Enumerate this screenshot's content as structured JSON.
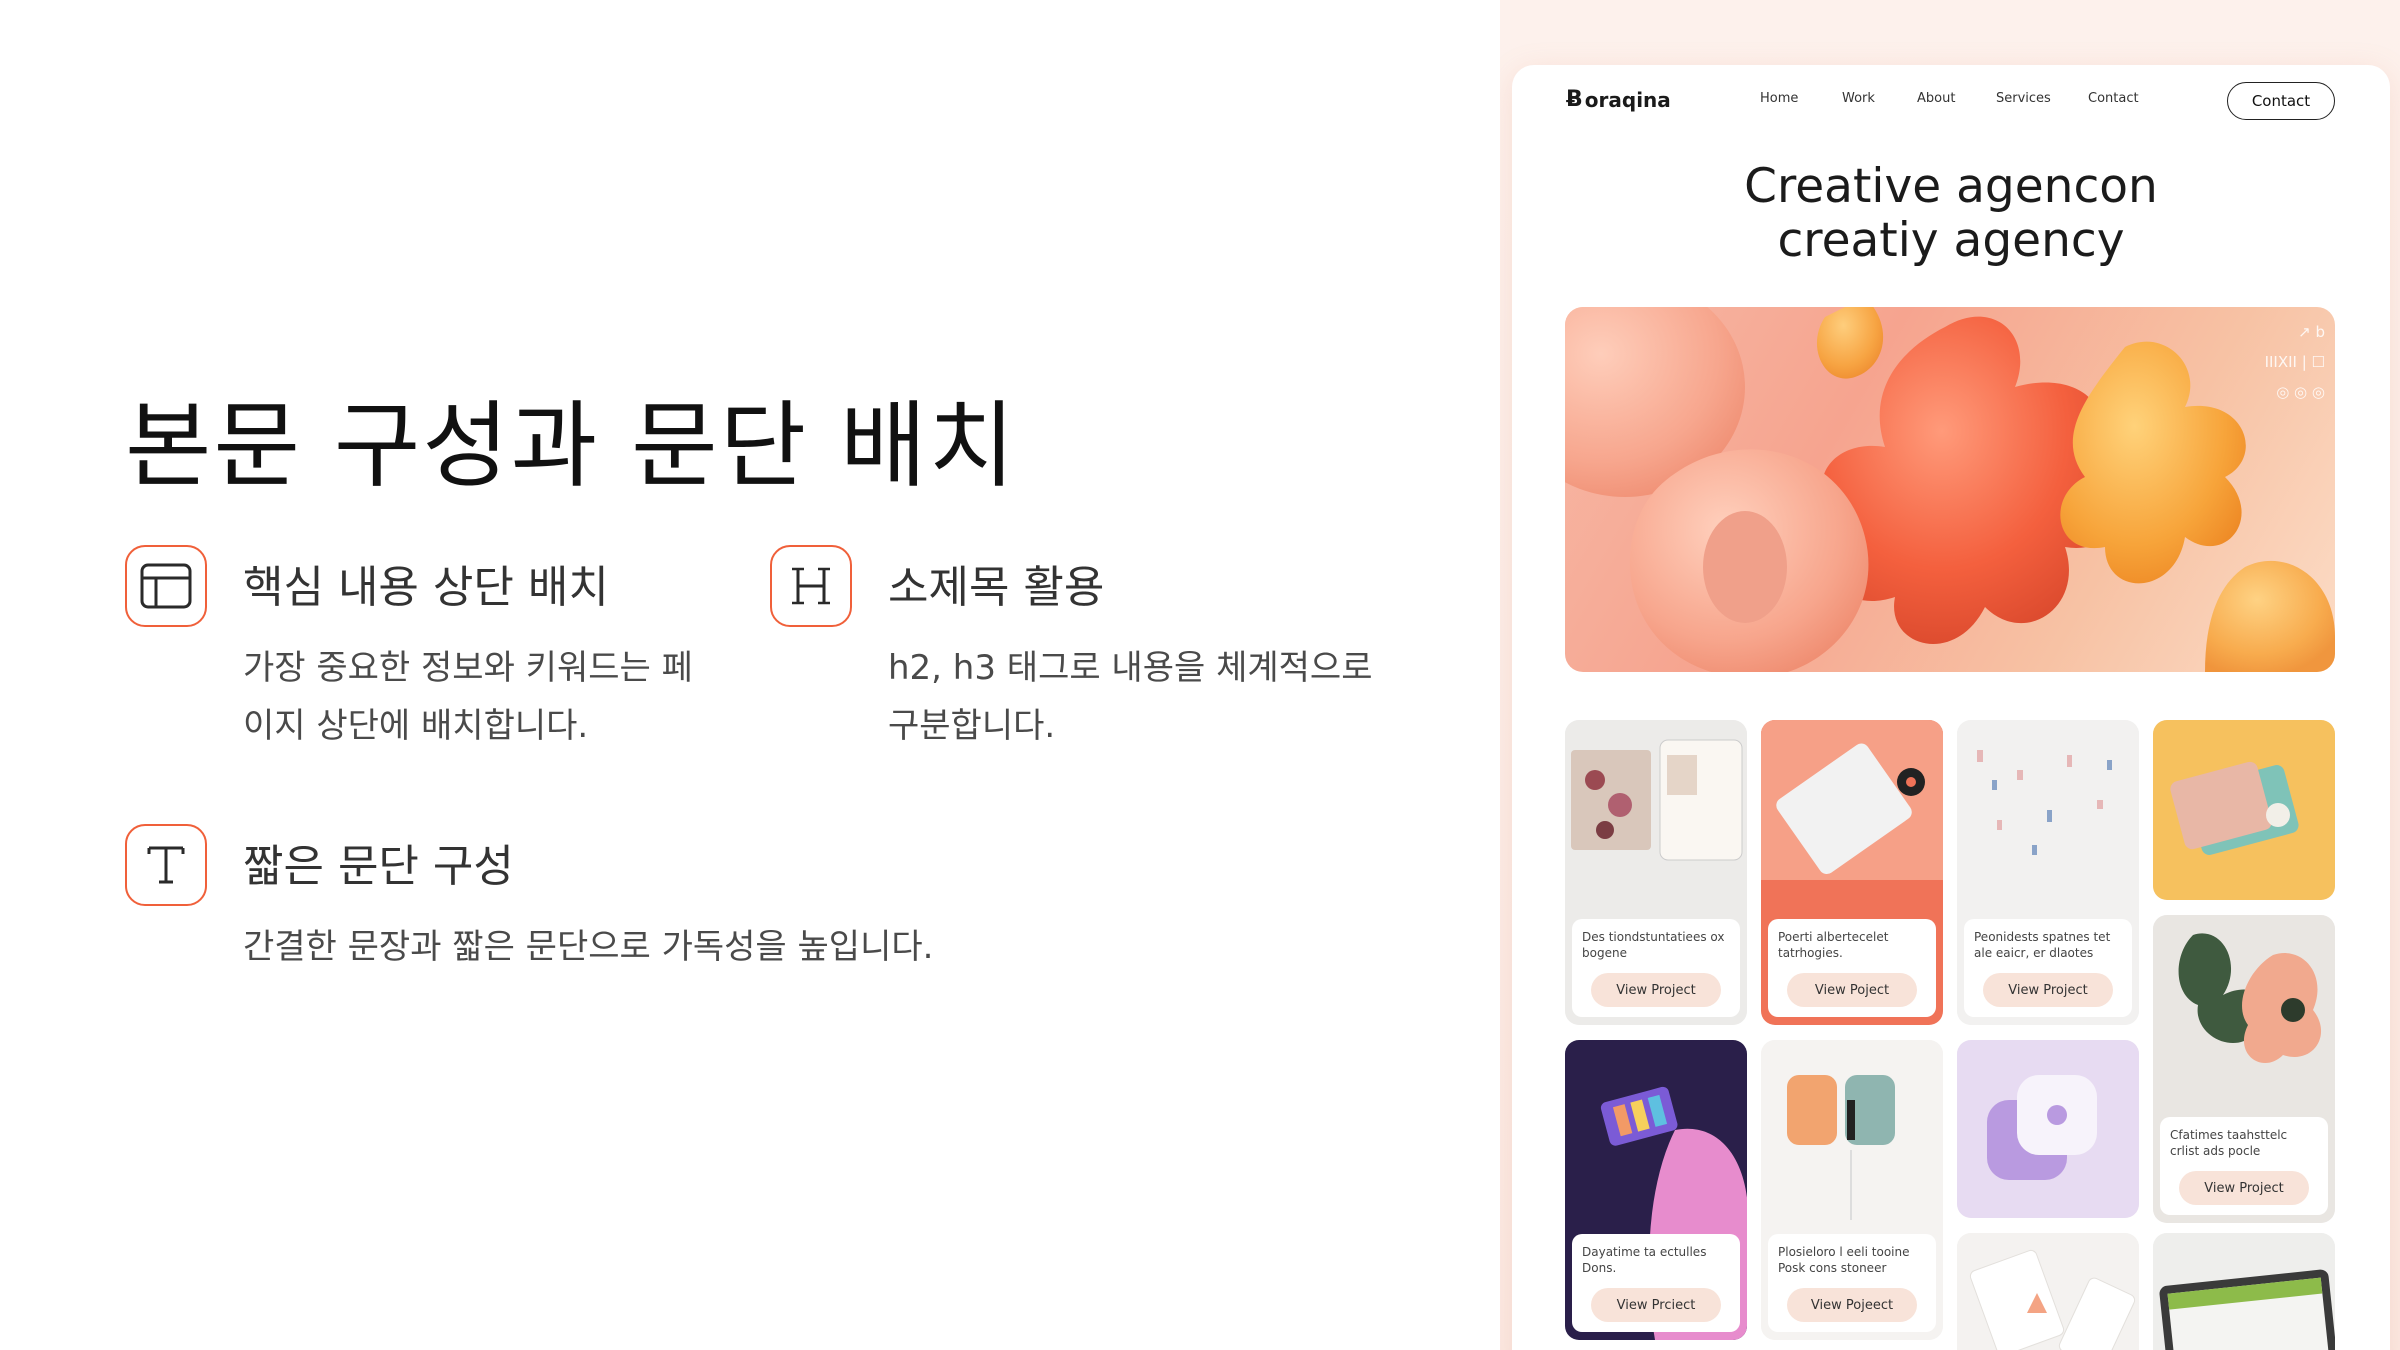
{
  "slide": {
    "title": "본문 구성과 문단 배치",
    "features": [
      {
        "icon": "layout-icon",
        "title": "핵심 내용 상단 배치",
        "desc": "가장 중요한 정보와 키워드는 페이지 상단에 배치합니다."
      },
      {
        "icon": "heading-h-icon",
        "title": "소제목 활용",
        "desc": "h2, h3 태그로 내용을 체계적으로 구분합니다."
      },
      {
        "icon": "text-t-icon",
        "title": "짧은 문단 구성",
        "desc": "간결한 문장과 짧은 문단으로 가독성을 높입니다."
      }
    ],
    "accent": "#f0603a"
  },
  "mockup": {
    "logo": "oraqina",
    "nav": [
      "Home",
      "Work",
      "About",
      "Services",
      "Contact"
    ],
    "cta": "Contact",
    "hero_title_line1": "Creative agencon",
    "hero_title_line2": "creatiy agency",
    "hero_icons_line1": "↗ b",
    "hero_icons_line2": "ΙΙΙΧΙΙ | ☐",
    "hero_icons_line3": "◎ ◎ ◎",
    "cards": [
      {
        "text": "Des tiondstuntatiees ox bogene",
        "button": "View Project"
      },
      {
        "text": "Poerti albertecelet tatrhogies.",
        "button": "View Poject"
      },
      {
        "text": "Peonidests spatnes tet ale eaicr, er dlaotes",
        "button": "View Project"
      },
      {
        "text": "Cfatimes taahsttelc crlist ads pocle",
        "button": "View Project"
      },
      {
        "text": "Dayatime ta ectulles Dons.",
        "button": "View Prciect"
      },
      {
        "text": "Plosieloro l eeli tooine Posk cons stoneer",
        "button": "View Pojeect"
      }
    ],
    "bg": "#fdf1ec"
  }
}
